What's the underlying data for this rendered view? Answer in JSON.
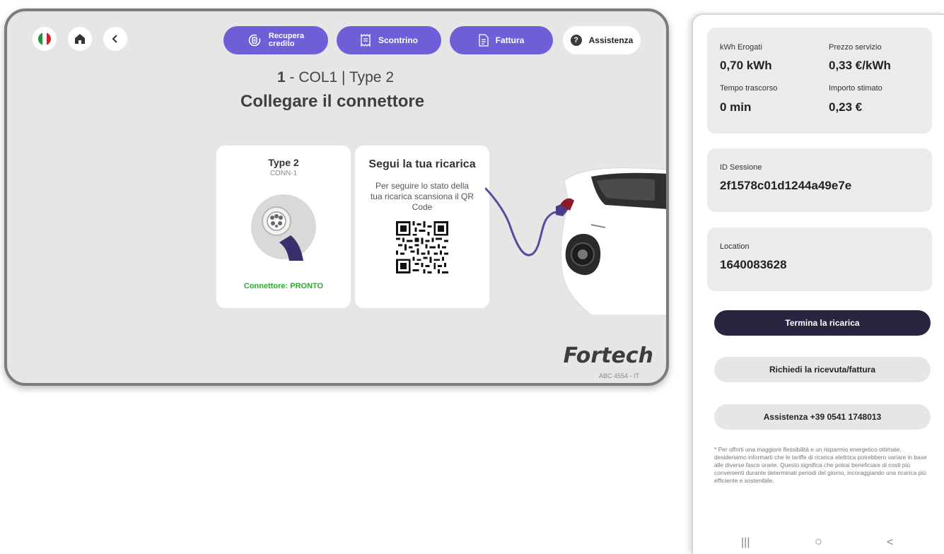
{
  "kiosk": {
    "toolbar": {
      "recupera_label_1": "Recupera",
      "recupera_label_2": "credito",
      "scontrino_label": "Scontrino",
      "fattura_label": "Fattura",
      "assistenza_label": "Assistenza",
      "help_glyph": "?"
    },
    "title": {
      "number": "1",
      "rest": " - COL1 | Type 2",
      "instruction": "Collegare il connettore"
    },
    "connector_card": {
      "type": "Type 2",
      "code": "CONN-1",
      "status": "Connettore: PRONTO"
    },
    "qr_card": {
      "title": "Segui la tua ricarica",
      "text": "Per seguire lo stato della tua ricarica scansiona il QR Code"
    },
    "brand": "Fortech",
    "plate": "ABC 4554 - IT",
    "colors": {
      "accent": "#6e5fd7",
      "ready": "#22b12b"
    }
  },
  "phone": {
    "kwh_label": "kWh Erogati",
    "kwh_value": "0,70 kWh",
    "price_label": "Prezzo servizio",
    "price_value": "0,33 €/kWh",
    "time_label": "Tempo trascorso",
    "time_value": "0 min",
    "amount_label": "Importo stimato",
    "amount_value": "0,23 €",
    "session_label": "ID Sessione",
    "session_value": "2f1578c01d1244a49e7e",
    "location_label": "Location",
    "location_value": "1640083628",
    "stop_button": "Termina la ricarica",
    "receipt_button": "Richiedi la ricevuta/fattura",
    "support_button": "Assistenza +39 0541 1748013",
    "note": "* Per offrirti una maggiore flessibilità e un risparmio energetico ottimale, desideriamo informarti che le tariffe di ricarica elettrica potrebbero variare in base alle diverse fasce orarie. Questo significa che potrai beneficiare di costi più convenienti durante determinati periodi del giorno, incoraggiando una ricarica più efficiente e sostenibile.",
    "nav": {
      "recent": "|||",
      "home": "○",
      "back": "<"
    },
    "colors": {
      "primary_button": "#2b2440"
    }
  }
}
